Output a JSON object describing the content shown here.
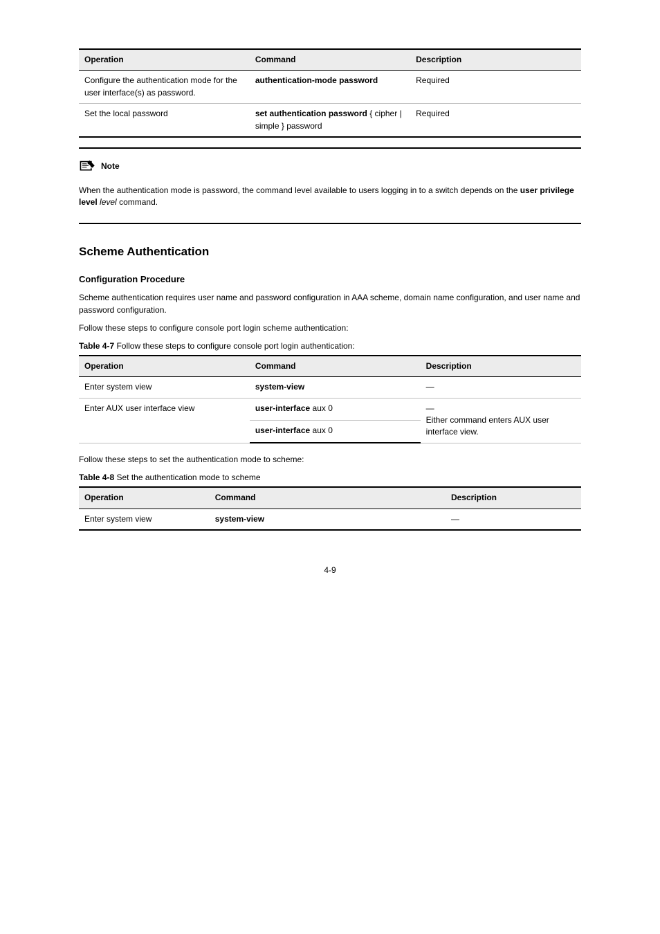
{
  "table1": {
    "header": {
      "c1": "Operation",
      "c2": "Command",
      "c3": "Description"
    },
    "rows": [
      {
        "op": "Configure the authentication mode for the user interface(s) as password.",
        "cmd_b": "authentication-mode password",
        "desc": "Required"
      },
      {
        "op": "Set the local password",
        "cmd_pre": "set authentication password",
        "cmd_b": "{ cipher | simple }",
        "cmd_post": " password",
        "desc": "Required"
      }
    ]
  },
  "note": {
    "label": "Note",
    "body": "When the authentication mode is password, the command level available to users logging in to a switch depends on the user privilege level level command."
  },
  "section_title": "Scheme Authentication",
  "subsection1": "Configuration Procedure",
  "para": "Scheme authentication requires user name and password configuration in AAA scheme, domain name configuration, and user name and password configuration.",
  "follow1": "Follow these steps to configure console port login scheme authentication:",
  "caption2": "Table 4-7 Follow these steps to configure console port login authentication:",
  "table2": {
    "header": {
      "c1": "Operation",
      "c2": "Command",
      "c3": "Description"
    },
    "rows": [
      {
        "op": "Enter system view",
        "cmd": "system-view",
        "desc": "—"
      },
      {
        "op": "Enter AUX user interface view",
        "cmd_b": "user-interface",
        "cmd_post": " aux 0",
        "desc_line1": "—",
        "desc_line2": "Either command enters AUX user interface view."
      },
      {
        "op": "",
        "cmd_b": "user-interface",
        "cmd_post": " aux 0",
        "desc": ""
      }
    ]
  },
  "follow2": "Follow these steps to set the authentication mode to scheme:",
  "caption3": "Table 4-8 Set the authentication mode to scheme",
  "table3": {
    "header": {
      "c1": "Operation",
      "c2": "Command",
      "c3": "Description"
    },
    "row": {
      "op": "Enter system view",
      "cmd": "system-view",
      "desc": "—"
    }
  },
  "page_num": "4-9"
}
